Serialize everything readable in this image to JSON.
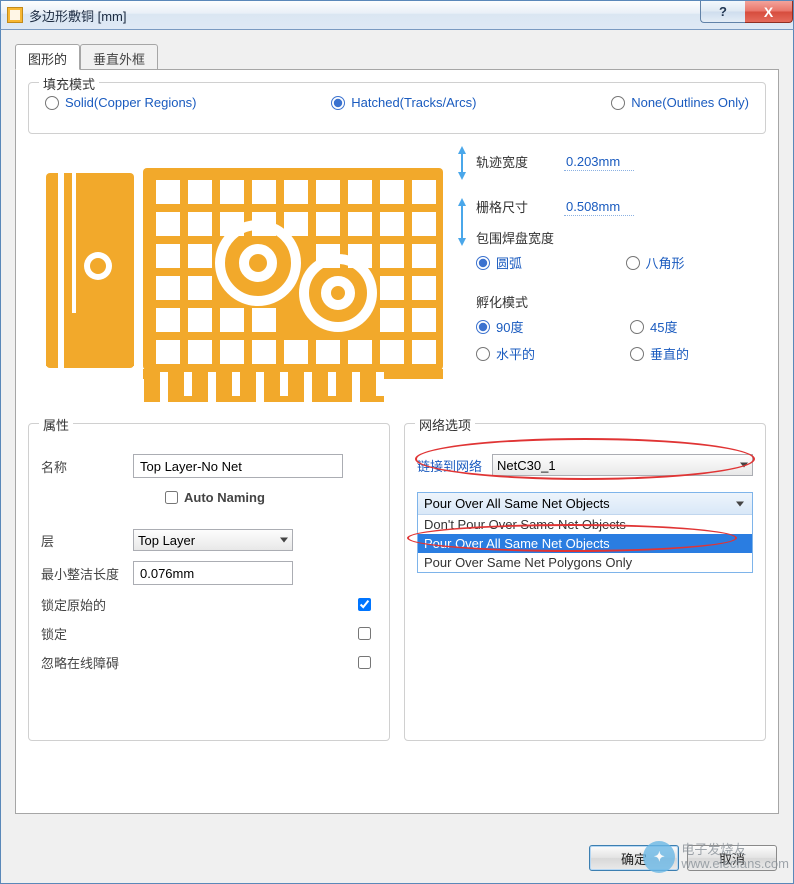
{
  "window": {
    "title": "多边形敷铜 [mm]",
    "help": "?",
    "close": "X"
  },
  "tabs": {
    "graphical": "图形的",
    "vertical": "垂直外框"
  },
  "fill_mode": {
    "legend": "填充模式",
    "solid": "Solid(Copper Regions)",
    "hatched": "Hatched(Tracks/Arcs)",
    "none": "None(Outlines Only)",
    "selected": "hatched"
  },
  "params": {
    "track_width_label": "轨迹宽度",
    "track_width_value": "0.203mm",
    "grid_size_label": "栅格尺寸",
    "grid_size_value": "0.508mm",
    "surround_pads_label": "包围焊盘宽度",
    "arc": "圆弧",
    "octagon": "八角形",
    "surround_selected": "arc",
    "hatch_mode_label": "孵化模式",
    "deg90": "90度",
    "deg45": "45度",
    "horizontal": "水平的",
    "vertical": "垂直的",
    "hatch_selected": "deg90"
  },
  "attributes": {
    "legend": "属性",
    "name_label": "名称",
    "name_value": "Top Layer-No Net",
    "auto_naming_label": "Auto Naming",
    "auto_naming_checked": false,
    "layer_label": "层",
    "layer_value": "Top Layer",
    "min_prim_label": "最小整洁长度",
    "min_prim_value": "0.076mm",
    "lock_primitives_label": "锁定原始的",
    "lock_primitives_checked": true,
    "locked_label": "锁定",
    "locked_checked": false,
    "ignore_obstacles_label": "忽略在线障碍",
    "ignore_obstacles_checked": false
  },
  "net_options": {
    "legend": "网络选项",
    "connect_label": "链接到网络",
    "connect_value": "NetC30_1",
    "pour_selected": "Pour Over All Same Net Objects",
    "pour_options": [
      "Don't Pour Over Same Net Objects",
      "Pour Over All Same Net Objects",
      "Pour Over Same Net Polygons Only"
    ],
    "pour_selected_index": 1
  },
  "buttons": {
    "ok": "确定",
    "cancel": "取消"
  },
  "watermark": {
    "line1": "电子发烧友",
    "line2": "www.elecfans.com"
  }
}
